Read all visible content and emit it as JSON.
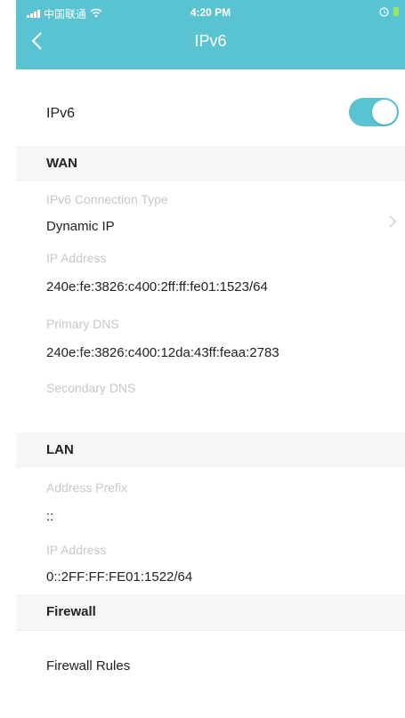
{
  "status_bar": {
    "carrier": "中国联通",
    "time": "4:20 PM"
  },
  "header": {
    "title": "IPv6"
  },
  "ipv6_toggle": {
    "label": "IPv6",
    "enabled": true
  },
  "wan": {
    "section_title": "WAN",
    "fields": [
      {
        "label": "IPv6 Connection Type",
        "value": "Dynamic IP"
      },
      {
        "label": "IP Address",
        "value": "240e:fe:3826:c400:2ff:ff:fe01:1523/64"
      },
      {
        "label": "Primary DNS",
        "value": "240e:fe:3826:c400:12da:43ff:feaa:2783"
      },
      {
        "label": "Secondary DNS",
        "value": ""
      }
    ]
  },
  "lan": {
    "section_title": "LAN",
    "fields": [
      {
        "label": "Address Prefix",
        "value": "::"
      },
      {
        "label": "IP Address",
        "value": "0::2FF:FF:FE01:1522/64"
      }
    ]
  },
  "firewall": {
    "section_title": "Firewall",
    "item_label": "Firewall Rules"
  },
  "colors": {
    "accent": "#59c3d1"
  }
}
